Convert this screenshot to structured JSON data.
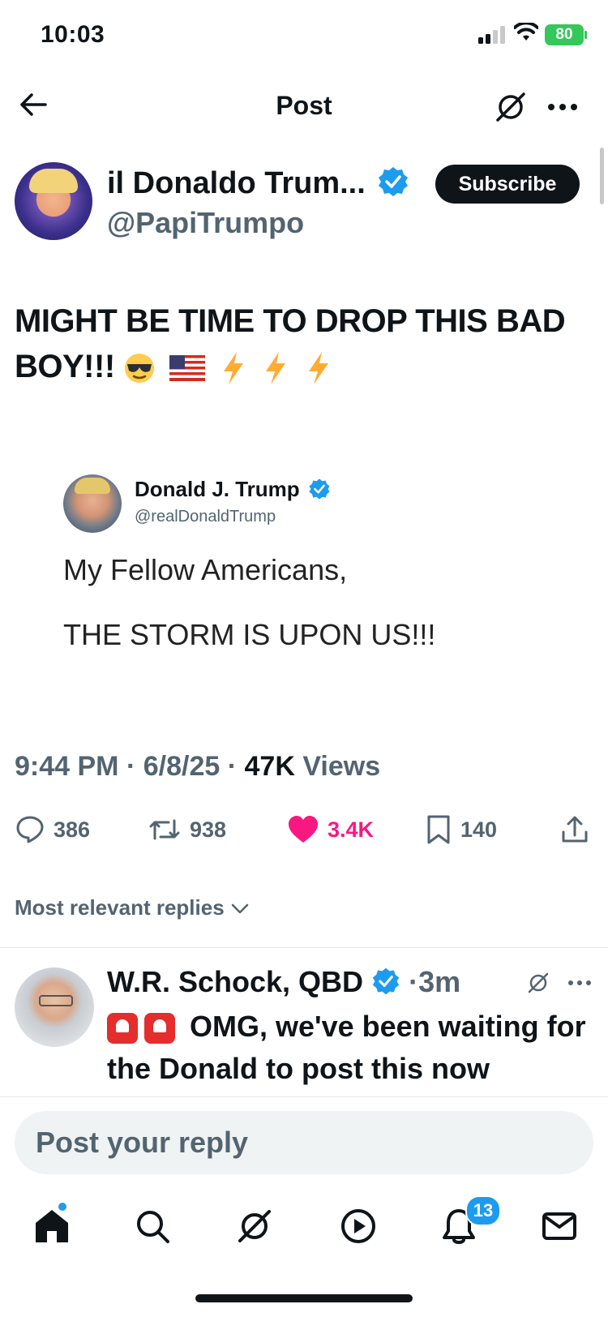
{
  "status_bar": {
    "time": "10:03",
    "battery": "80"
  },
  "header": {
    "title": "Post",
    "icons": [
      "back-arrow-icon",
      "grok-icon",
      "more-icon"
    ]
  },
  "author": {
    "name": "il Donaldo Trum...",
    "handle": "@PapiTrumpo",
    "subscribe_label": "Subscribe"
  },
  "tweet": {
    "text": "MIGHT BE TIME TO DROP THIS BAD BOY!!!",
    "emojis": [
      "sunglasses-emoji",
      "us-flag-emoji",
      "lightning-emoji",
      "lightning-emoji",
      "lightning-emoji"
    ]
  },
  "quoted_image": {
    "name": "Donald J. Trump",
    "handle": "@realDonaldTrump",
    "line1": "My Fellow Americans,",
    "line2": "THE STORM IS UPON US!!!"
  },
  "meta": {
    "time": "9:44 PM",
    "date": "6/8/25",
    "views_count": "47K",
    "views_label": "Views",
    "separator": "·"
  },
  "actions": {
    "replies": "386",
    "reposts": "938",
    "likes": "3.4K",
    "bookmarks": "140"
  },
  "colors": {
    "like": "#f91880",
    "verified": "#1d9bf0",
    "text": "#0f1419",
    "secondary": "#536471"
  },
  "replies_filter": "Most relevant replies",
  "reply": {
    "name": "W.R. Schock, QBD",
    "time": "3m",
    "text": "OMG, we've been waiting for the Donald to post this now"
  },
  "reply_input": {
    "placeholder": "Post your reply"
  },
  "tab_bar": {
    "notifications_badge": "13",
    "icons": [
      "home-icon",
      "search-icon",
      "grok-icon",
      "video-icon",
      "notifications-icon",
      "messages-icon"
    ]
  }
}
